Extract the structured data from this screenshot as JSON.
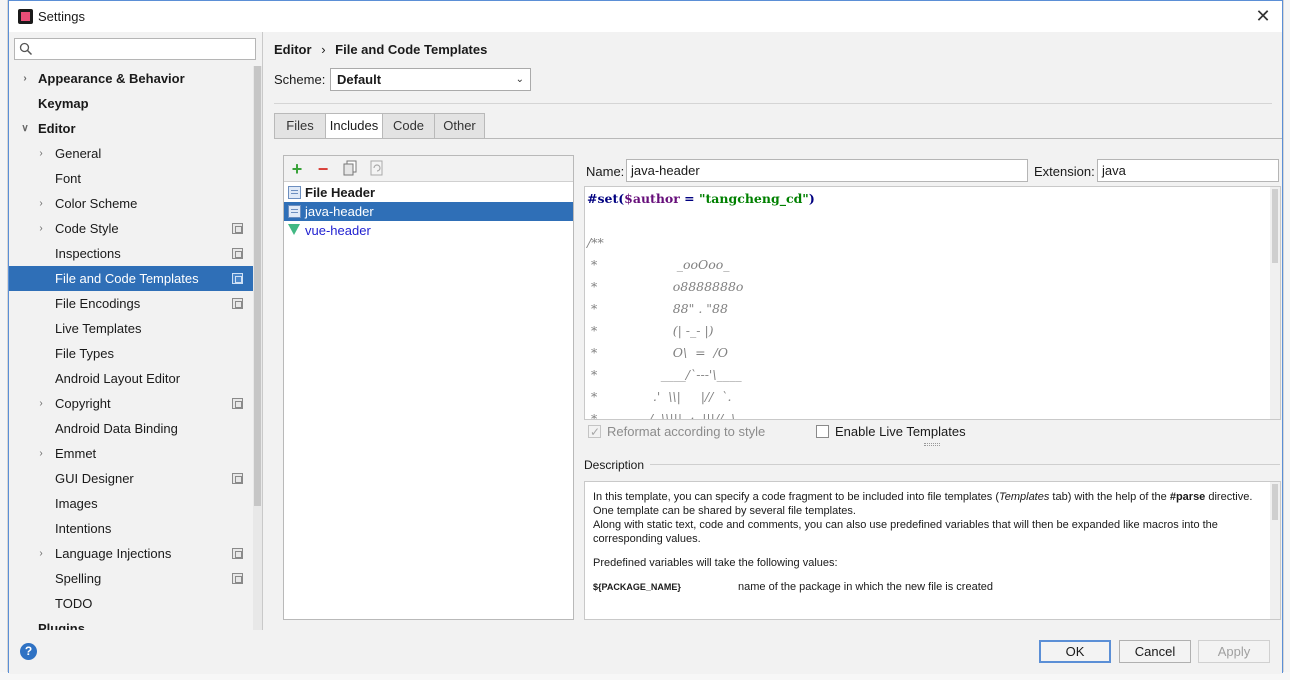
{
  "window": {
    "title": "Settings"
  },
  "search": {
    "placeholder": ""
  },
  "sidebar": {
    "items": [
      {
        "label": "Appearance & Behavior",
        "bold": true,
        "arrow": "right",
        "level": 0
      },
      {
        "label": "Keymap",
        "bold": true,
        "arrow": "",
        "level": 0
      },
      {
        "label": "Editor",
        "bold": true,
        "arrow": "down",
        "level": 0
      },
      {
        "label": "General",
        "arrow": "right",
        "level": 1
      },
      {
        "label": "Font",
        "arrow": "",
        "level": 1
      },
      {
        "label": "Color Scheme",
        "arrow": "right",
        "level": 1
      },
      {
        "label": "Code Style",
        "arrow": "right",
        "level": 1,
        "project": true
      },
      {
        "label": "Inspections",
        "arrow": "",
        "level": 1,
        "project": true
      },
      {
        "label": "File and Code Templates",
        "arrow": "",
        "level": 1,
        "project": true,
        "selected": true
      },
      {
        "label": "File Encodings",
        "arrow": "",
        "level": 1,
        "project": true
      },
      {
        "label": "Live Templates",
        "arrow": "",
        "level": 1
      },
      {
        "label": "File Types",
        "arrow": "",
        "level": 1
      },
      {
        "label": "Android Layout Editor",
        "arrow": "",
        "level": 1
      },
      {
        "label": "Copyright",
        "arrow": "right",
        "level": 1,
        "project": true
      },
      {
        "label": "Android Data Binding",
        "arrow": "",
        "level": 1
      },
      {
        "label": "Emmet",
        "arrow": "right",
        "level": 1
      },
      {
        "label": "GUI Designer",
        "arrow": "",
        "level": 1,
        "project": true
      },
      {
        "label": "Images",
        "arrow": "",
        "level": 1
      },
      {
        "label": "Intentions",
        "arrow": "",
        "level": 1
      },
      {
        "label": "Language Injections",
        "arrow": "right",
        "level": 1,
        "project": true
      },
      {
        "label": "Spelling",
        "arrow": "",
        "level": 1,
        "project": true
      },
      {
        "label": "TODO",
        "arrow": "",
        "level": 1
      },
      {
        "label": "Plugins",
        "bold": true,
        "arrow": "",
        "level": 0
      }
    ]
  },
  "breadcrumb": {
    "part1": "Editor",
    "separator": "›",
    "part2": "File and Code Templates"
  },
  "scheme": {
    "label": "Scheme:",
    "value": "Default"
  },
  "tabs": [
    {
      "label": "Files"
    },
    {
      "label": "Includes",
      "active": true
    },
    {
      "label": "Code"
    },
    {
      "label": "Other"
    }
  ],
  "templates": [
    {
      "label": "File Header",
      "bold": true,
      "icon": "file-icon"
    },
    {
      "label": "java-header",
      "selected": true,
      "icon": "file-icon"
    },
    {
      "label": "vue-header",
      "icon": "vue-icon",
      "color": "#1f1fd0"
    }
  ],
  "form": {
    "name_label": "Name:",
    "name_value": "java-header",
    "ext_label": "Extension:",
    "ext_value": "java"
  },
  "editor": {
    "first_line": {
      "kw": "#set(",
      "var": "$author",
      "mid": " = ",
      "str": "\"tangcheng_cd\"",
      "end": ")"
    },
    "lines": [
      "",
      "/**",
      " *                    _ooOoo_",
      " *                   o8888888o",
      " *                   88\" . \"88",
      " *                   (| -_- |)",
      " *                   O\\  =  /O",
      " *                ____/`---'\\____",
      " *              .'  \\\\|     |//  `.",
      " *             /  \\\\|||  :  |||//  \\"
    ]
  },
  "options": {
    "reformat_label": "Reformat according to style",
    "live_templates_label": "Enable Live Templates"
  },
  "description": {
    "header": "Description",
    "p1_pre": "In this template, you can specify a code fragment to be included into file templates (",
    "p1_em": "Templates",
    "p1_mid": " tab) with the help of the ",
    "p1_bold": "#parse",
    "p1_post": " directive.",
    "p2": "One template can be shared by several file templates.",
    "p3": "Along with static text, code and comments, you can also use predefined variables that will then be expanded like macros into the corresponding values.",
    "p4": "Predefined variables will take the following values:",
    "var_name": "${PACKAGE_NAME}",
    "var_desc": "name of the package in which the new file is created"
  },
  "buttons": {
    "ok": "OK",
    "cancel": "Cancel",
    "apply": "Apply"
  },
  "colors": {
    "selection": "#2f6fb7",
    "accent": "#5b8fd6"
  }
}
